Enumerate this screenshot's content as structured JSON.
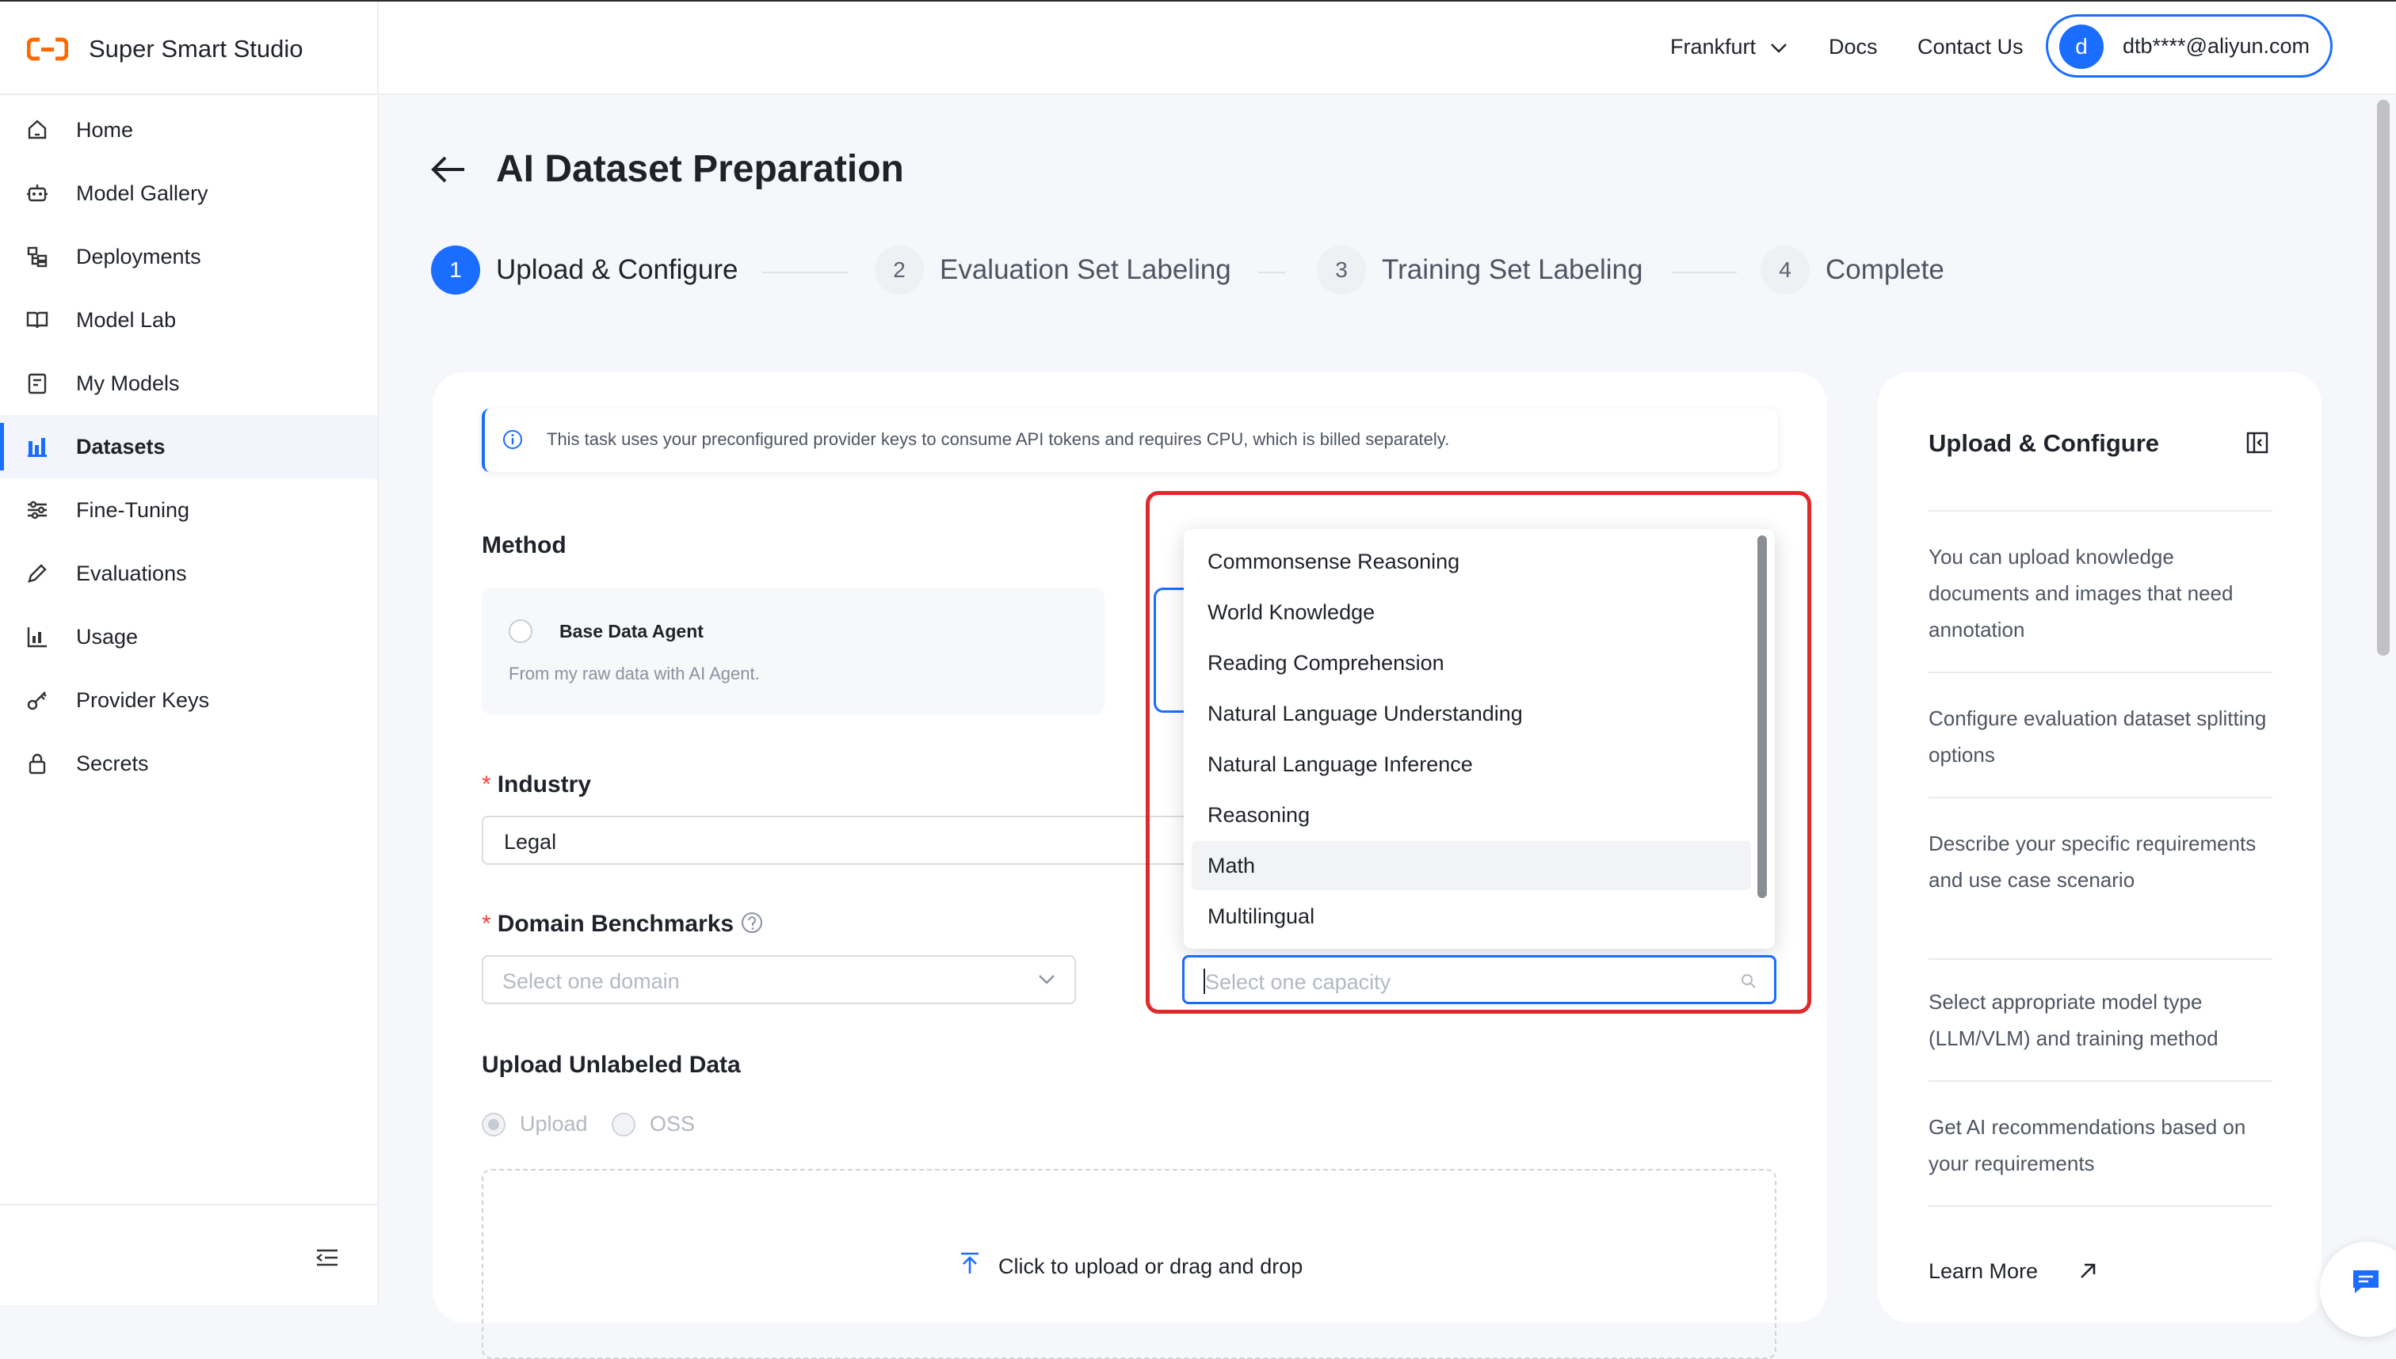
{
  "app": {
    "name": "Super Smart Studio"
  },
  "sidebar": {
    "items": [
      {
        "label": "Home",
        "icon": "home-icon"
      },
      {
        "label": "Model Gallery",
        "icon": "robot-icon"
      },
      {
        "label": "Deployments",
        "icon": "deployments-icon"
      },
      {
        "label": "Model Lab",
        "icon": "book-icon"
      },
      {
        "label": "My Models",
        "icon": "models-icon"
      },
      {
        "label": "Datasets",
        "icon": "bar-chart-icon",
        "active": true
      },
      {
        "label": "Fine-Tuning",
        "icon": "sliders-icon"
      },
      {
        "label": "Evaluations",
        "icon": "pencil-icon"
      },
      {
        "label": "Usage",
        "icon": "usage-chart-icon"
      },
      {
        "label": "Provider Keys",
        "icon": "key-icon"
      },
      {
        "label": "Secrets",
        "icon": "lock-icon"
      }
    ]
  },
  "header": {
    "region": "Frankfurt",
    "docs": "Docs",
    "contact": "Contact Us",
    "user_initial": "d",
    "user_email": "dtb****@aliyun.com"
  },
  "page": {
    "title": "AI Dataset Preparation"
  },
  "steps": [
    {
      "num": "1",
      "label": "Upload & Configure",
      "active": true
    },
    {
      "num": "2",
      "label": "Evaluation Set Labeling"
    },
    {
      "num": "3",
      "label": "Training Set Labeling"
    },
    {
      "num": "4",
      "label": "Complete"
    }
  ],
  "form": {
    "info_notice": "This task uses your preconfigured provider keys to consume API tokens and requires CPU, which is billed separately.",
    "method_label": "Method",
    "method_option": {
      "title": "Base Data Agent",
      "desc": "From my raw data with AI Agent."
    },
    "industry_label": "Industry",
    "industry_value": "Legal",
    "benchmarks_label": "Domain Benchmarks",
    "domain_placeholder": "Select one domain",
    "capacity_placeholder": "Select one capacity",
    "capacity_options": [
      "Commonsense Reasoning",
      "World Knowledge",
      "Reading Comprehension",
      "Natural Language Understanding",
      "Natural Language Inference",
      "Reasoning",
      "Math",
      "Multilingual"
    ],
    "hovered_option": "Math",
    "upload_label": "Upload Unlabeled Data",
    "upload_source_options": [
      "Upload",
      "OSS"
    ],
    "upload_prompt": "Click to upload or drag and drop",
    "required_mark": "*"
  },
  "right_panel": {
    "title": "Upload & Configure",
    "tips": [
      "You can upload knowledge documents and images that need annotation",
      "Configure evaluation dataset splitting options",
      "Describe your specific requirements and use case scenario",
      "Select appropriate model type (LLM/VLM) and training method",
      "Get AI recommendations based on your requirements"
    ],
    "learn_more": "Learn More"
  },
  "colors": {
    "accent": "#1a6dff",
    "highlight": "#e02a2a",
    "brand_orange": "#ff6a00"
  }
}
